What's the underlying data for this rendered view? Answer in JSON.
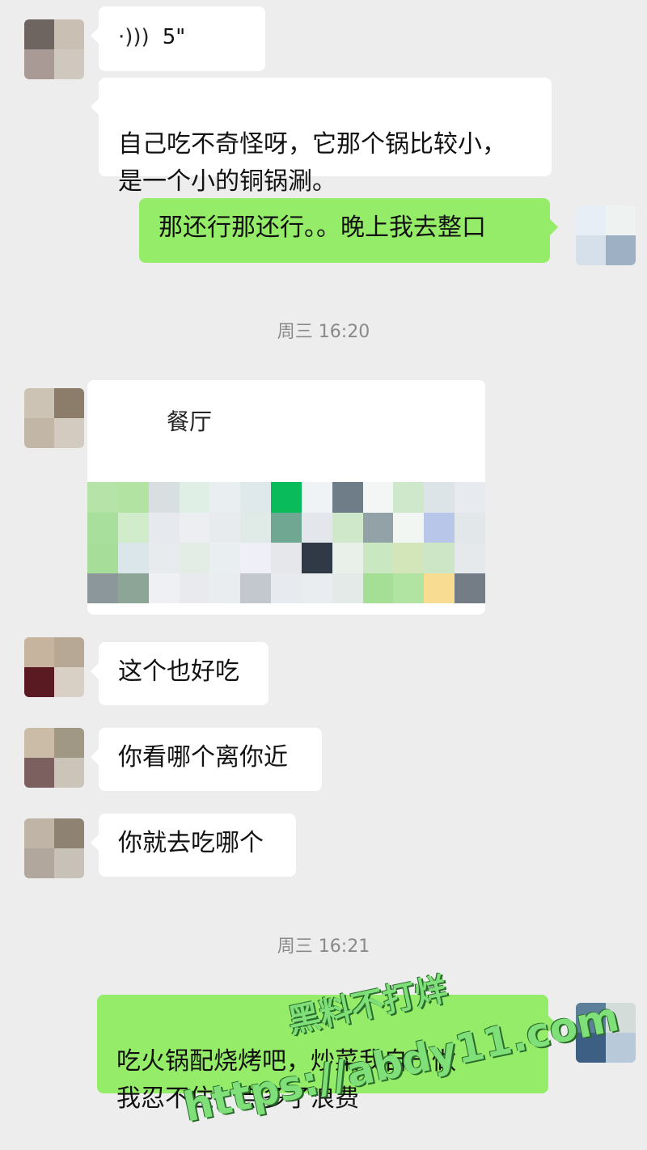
{
  "messages": [
    {
      "type": "voice",
      "duration": "5\""
    },
    {
      "type": "text",
      "text": "自己吃不奇怪呀，它那个锅比较小，\n是一个小的铜锅涮。"
    },
    {
      "type": "text_out",
      "text": "那还行那还行。。晚上我去整口"
    },
    {
      "type": "time",
      "text": "周三 16:20"
    },
    {
      "type": "card",
      "title": "餐厅"
    },
    {
      "type": "text",
      "text": "这个也好吃"
    },
    {
      "type": "text",
      "text": "你看哪个离你近"
    },
    {
      "type": "text",
      "text": "你就去吃哪个"
    },
    {
      "type": "time",
      "text": "周三 16:21"
    },
    {
      "type": "text_out",
      "text": "吃火锅配烧烤吧，炒菜我自己做\n我忍不住，点多了浪费"
    }
  ],
  "watermark": {
    "line1": "黑料不打烊",
    "line2": "https://abdy11.com"
  },
  "icons": {
    "voice": "voice-wave-icon"
  }
}
